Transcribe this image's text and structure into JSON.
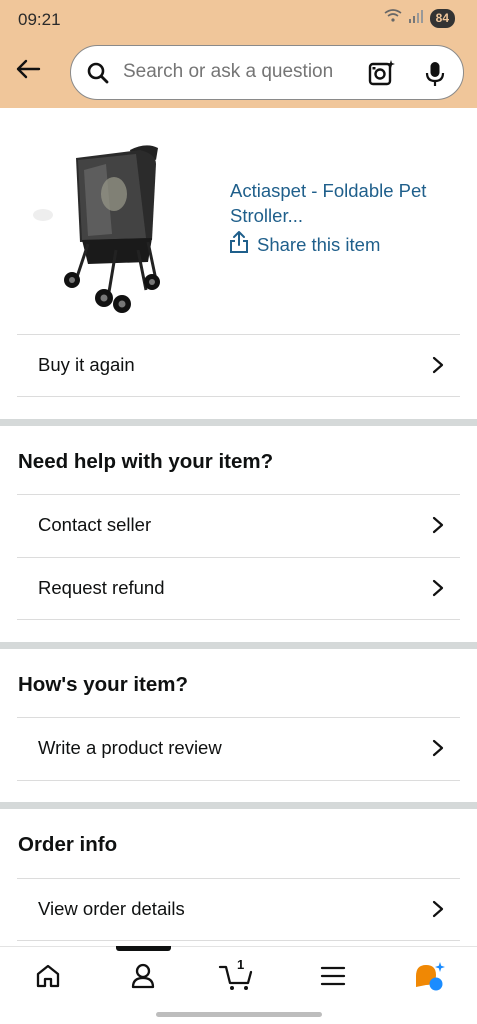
{
  "status_bar": {
    "time": "09:21",
    "battery": "84"
  },
  "search": {
    "placeholder": "Search or ask a question"
  },
  "product": {
    "title": "Actiaspet - Foldable Pet Stroller...",
    "share_label": "Share this item"
  },
  "rows": {
    "buy_again": "Buy it again",
    "contact_seller": "Contact seller",
    "request_refund": "Request refund",
    "write_review": "Write a product review",
    "view_order_details": "View order details"
  },
  "sections": {
    "need_help": "Need help with your item?",
    "hows_item": "How's your item?",
    "order_info": "Order info"
  },
  "bottom_nav": {
    "active": "profile",
    "cart_count": "1",
    "items": [
      "home-icon",
      "profile-icon",
      "cart-icon",
      "menu-icon",
      "rufus-icon"
    ]
  },
  "colors": {
    "header": "#f0c69a",
    "link": "#1f5f8b",
    "accent": "#f08804",
    "ai_blue": "#1a8cff"
  }
}
